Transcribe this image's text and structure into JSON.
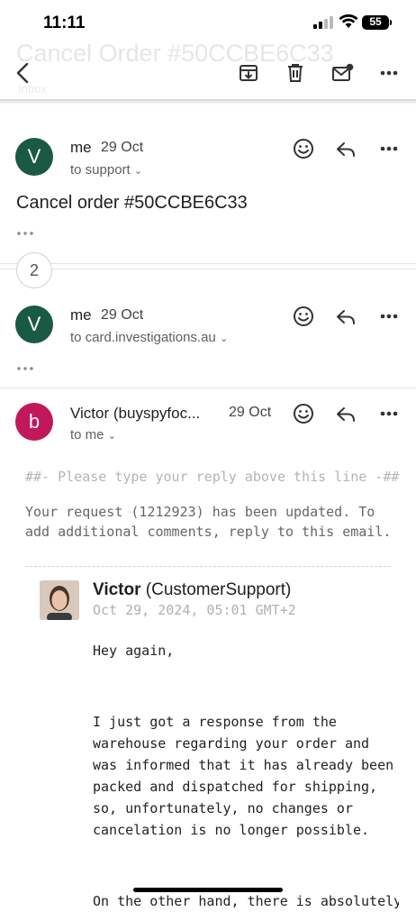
{
  "status_bar": {
    "time": "11:11",
    "battery": "55"
  },
  "header": {
    "title": "Cancel Order #50CCBE6C33",
    "label": "Inbox"
  },
  "messages": [
    {
      "avatar_letter": "V",
      "avatar_color": "#1a5a45",
      "sender": "me",
      "date": "29 Oct",
      "recipient": "to support",
      "snippet": "Cancel order #50CCBE6C33"
    },
    {
      "avatar_letter": "V",
      "avatar_color": "#1a5a45",
      "sender": "me",
      "date": "29 Oct",
      "recipient": "to card.investigations.au"
    },
    {
      "avatar_letter": "b",
      "avatar_color": "#c2185b",
      "sender": "Victor (buyspyfoc...",
      "date": "29 Oct",
      "recipient": "to me"
    }
  ],
  "collapsed_count": "2",
  "email_body": {
    "reply_hint": "##- Please type your reply above this line -##",
    "request_text": "Your request (1212923) has been updated. To add additional comments, reply to this email.",
    "agent_name": "Victor",
    "agent_role": "(CustomerSupport)",
    "agent_date": "Oct 29, 2024, 05:01 GMT+2",
    "greeting": "Hey again,",
    "paragraph1": "I just got a response from the warehouse regarding your order and was informed that it has already been packed and dispatched for shipping, so, unfortunately, no changes or cancelation is no longer possible.",
    "paragraph2": "On the other hand, there is absolutely"
  },
  "colors": {
    "accent_dark_green": "#1a5a45",
    "accent_magenta": "#c2185b"
  }
}
